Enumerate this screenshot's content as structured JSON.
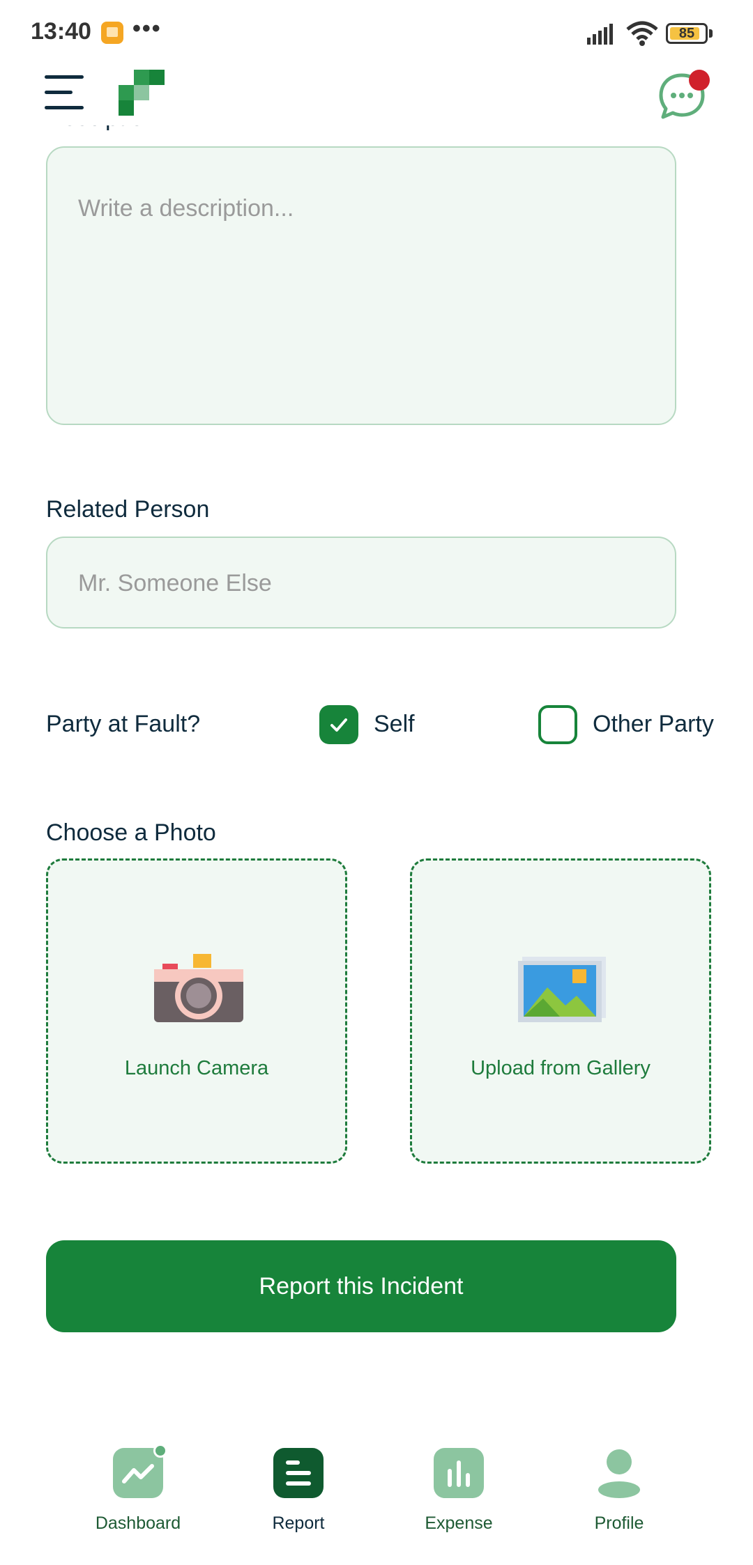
{
  "status_bar": {
    "time": "13:40",
    "dots": "•••",
    "battery": "85"
  },
  "header": {
    "menu_icon": "hamburger-menu-icon",
    "logo": "app-logo",
    "chat_icon": "chat-bubble-icon"
  },
  "form": {
    "description_label": "Desciption",
    "description_placeholder": "Write a description...",
    "related_person_label": "Related Person",
    "related_person_placeholder": "Mr. Someone Else",
    "fault_label": "Party at Fault?",
    "fault_options": [
      {
        "label": "Self",
        "checked": true
      },
      {
        "label": "Other Party",
        "checked": false
      }
    ],
    "photo_label": "Choose a Photo",
    "photo_options": [
      {
        "label": "Launch Camera",
        "icon": "camera-icon"
      },
      {
        "label": "Upload from Gallery",
        "icon": "gallery-icon"
      }
    ],
    "submit_label": "Report this Incident"
  },
  "bottom_nav": {
    "items": [
      {
        "label": "Dashboard",
        "icon": "dashboard-chart-icon",
        "active": false
      },
      {
        "label": "Report",
        "icon": "report-list-icon",
        "active": true
      },
      {
        "label": "Expense",
        "icon": "bar-chart-icon",
        "active": false
      },
      {
        "label": "Profile",
        "icon": "person-icon",
        "active": false
      }
    ]
  },
  "colors": {
    "primary": "#17843a",
    "field_bg": "#f1f8f3",
    "badge": "#d0212b"
  }
}
